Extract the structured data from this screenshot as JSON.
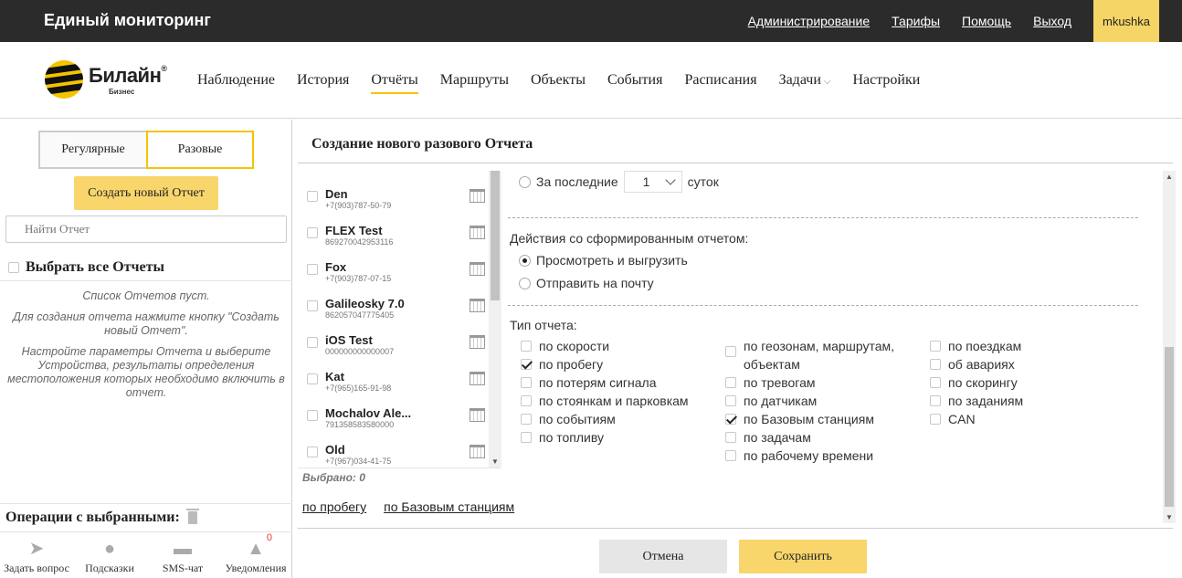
{
  "header": {
    "app_title": "Единый мониторинг",
    "links": [
      "Администрирование",
      "Тарифы",
      "Помощь",
      "Выход"
    ],
    "user": "mkushka"
  },
  "logo": {
    "name": "Билайн",
    "sub": "Бизнес",
    "icon": "beeline-logo-icon"
  },
  "nav": {
    "items": [
      "Наблюдение",
      "История",
      "Отчёты",
      "Маршруты",
      "Объекты",
      "События",
      "Расписания",
      "Задачи",
      "Настройки"
    ],
    "active": "Отчёты"
  },
  "left": {
    "tab_regular": "Регулярные",
    "tab_one_time": "Разовые",
    "create_button": "Создать новый Отчет",
    "search_placeholder": "Найти Отчет",
    "select_all": "Выбрать все Отчеты",
    "empty_messages": [
      "Список Отчетов пуст.",
      "Для создания отчета нажмите кнопку \"Создать новый Отчет\".",
      "Настройте параметры Отчета и выберите Устройства, результаты определения местоположения которых необходимо включить в отчет."
    ],
    "operations_label": "Операции с выбранными:",
    "tools": [
      {
        "label": "Задать вопрос",
        "icon": "paper-plane-icon"
      },
      {
        "label": "Подсказки",
        "icon": "lightbulb-icon"
      },
      {
        "label": "SMS-чат",
        "icon": "chat-icon"
      },
      {
        "label": "Уведомления",
        "icon": "warning-icon",
        "badge": "0"
      }
    ]
  },
  "main": {
    "title": "Создание нового разового Отчета",
    "devices": [
      {
        "name": "Den",
        "sub": "+7(903)787-50-79"
      },
      {
        "name": "FLEX Test",
        "sub": "869270042953116"
      },
      {
        "name": "Fox",
        "sub": "+7(903)787-07-15"
      },
      {
        "name": "Galileosky 7.0",
        "sub": "862057047775405"
      },
      {
        "name": "iOS Test",
        "sub": "000000000000007"
      },
      {
        "name": "Kat",
        "sub": "+7(965)165-91-98"
      },
      {
        "name": "Mochalov Ale...",
        "sub": "791358583580000"
      },
      {
        "name": "Old",
        "sub": "+7(967)034-41-75"
      }
    ],
    "selected_count": "Выбрано: 0",
    "period": {
      "prefix": "За последние",
      "value": "1",
      "suffix": "суток"
    },
    "actions_label": "Действия со сформированным отчетом:",
    "action_view": "Просмотреть и выгрузить",
    "action_mail": "Отправить на почту",
    "type_label": "Тип отчета:",
    "types": [
      {
        "label": "по скорости",
        "checked": false
      },
      {
        "label": "по пробегу",
        "checked": true
      },
      {
        "label": "по потерям сигнала",
        "checked": false
      },
      {
        "label": "по стоянкам и парковкам",
        "checked": false
      },
      {
        "label": "по событиям",
        "checked": false
      },
      {
        "label": "по топливу",
        "checked": false
      },
      {
        "label": "по геозонам, маршрутам, объектам",
        "checked": false
      },
      {
        "label": "по тревогам",
        "checked": false
      },
      {
        "label": "по датчикам",
        "checked": false
      },
      {
        "label": "по Базовым станциям",
        "checked": true
      },
      {
        "label": "по задачам",
        "checked": false
      },
      {
        "label": "по рабочему времени",
        "checked": false
      },
      {
        "label": "по поездкам",
        "checked": false
      },
      {
        "label": "об авариях",
        "checked": false
      },
      {
        "label": "по скорингу",
        "checked": false
      },
      {
        "label": "по заданиям",
        "checked": false
      },
      {
        "label": "CAN",
        "checked": false
      }
    ],
    "chosen_types": [
      "по пробегу",
      "по Базовым станциям"
    ],
    "cancel_button": "Отмена",
    "save_button": "Сохранить"
  },
  "colors": {
    "accent": "#f5c400",
    "button_yellow": "#f8d66b",
    "topbar": "#2b2b2b"
  }
}
